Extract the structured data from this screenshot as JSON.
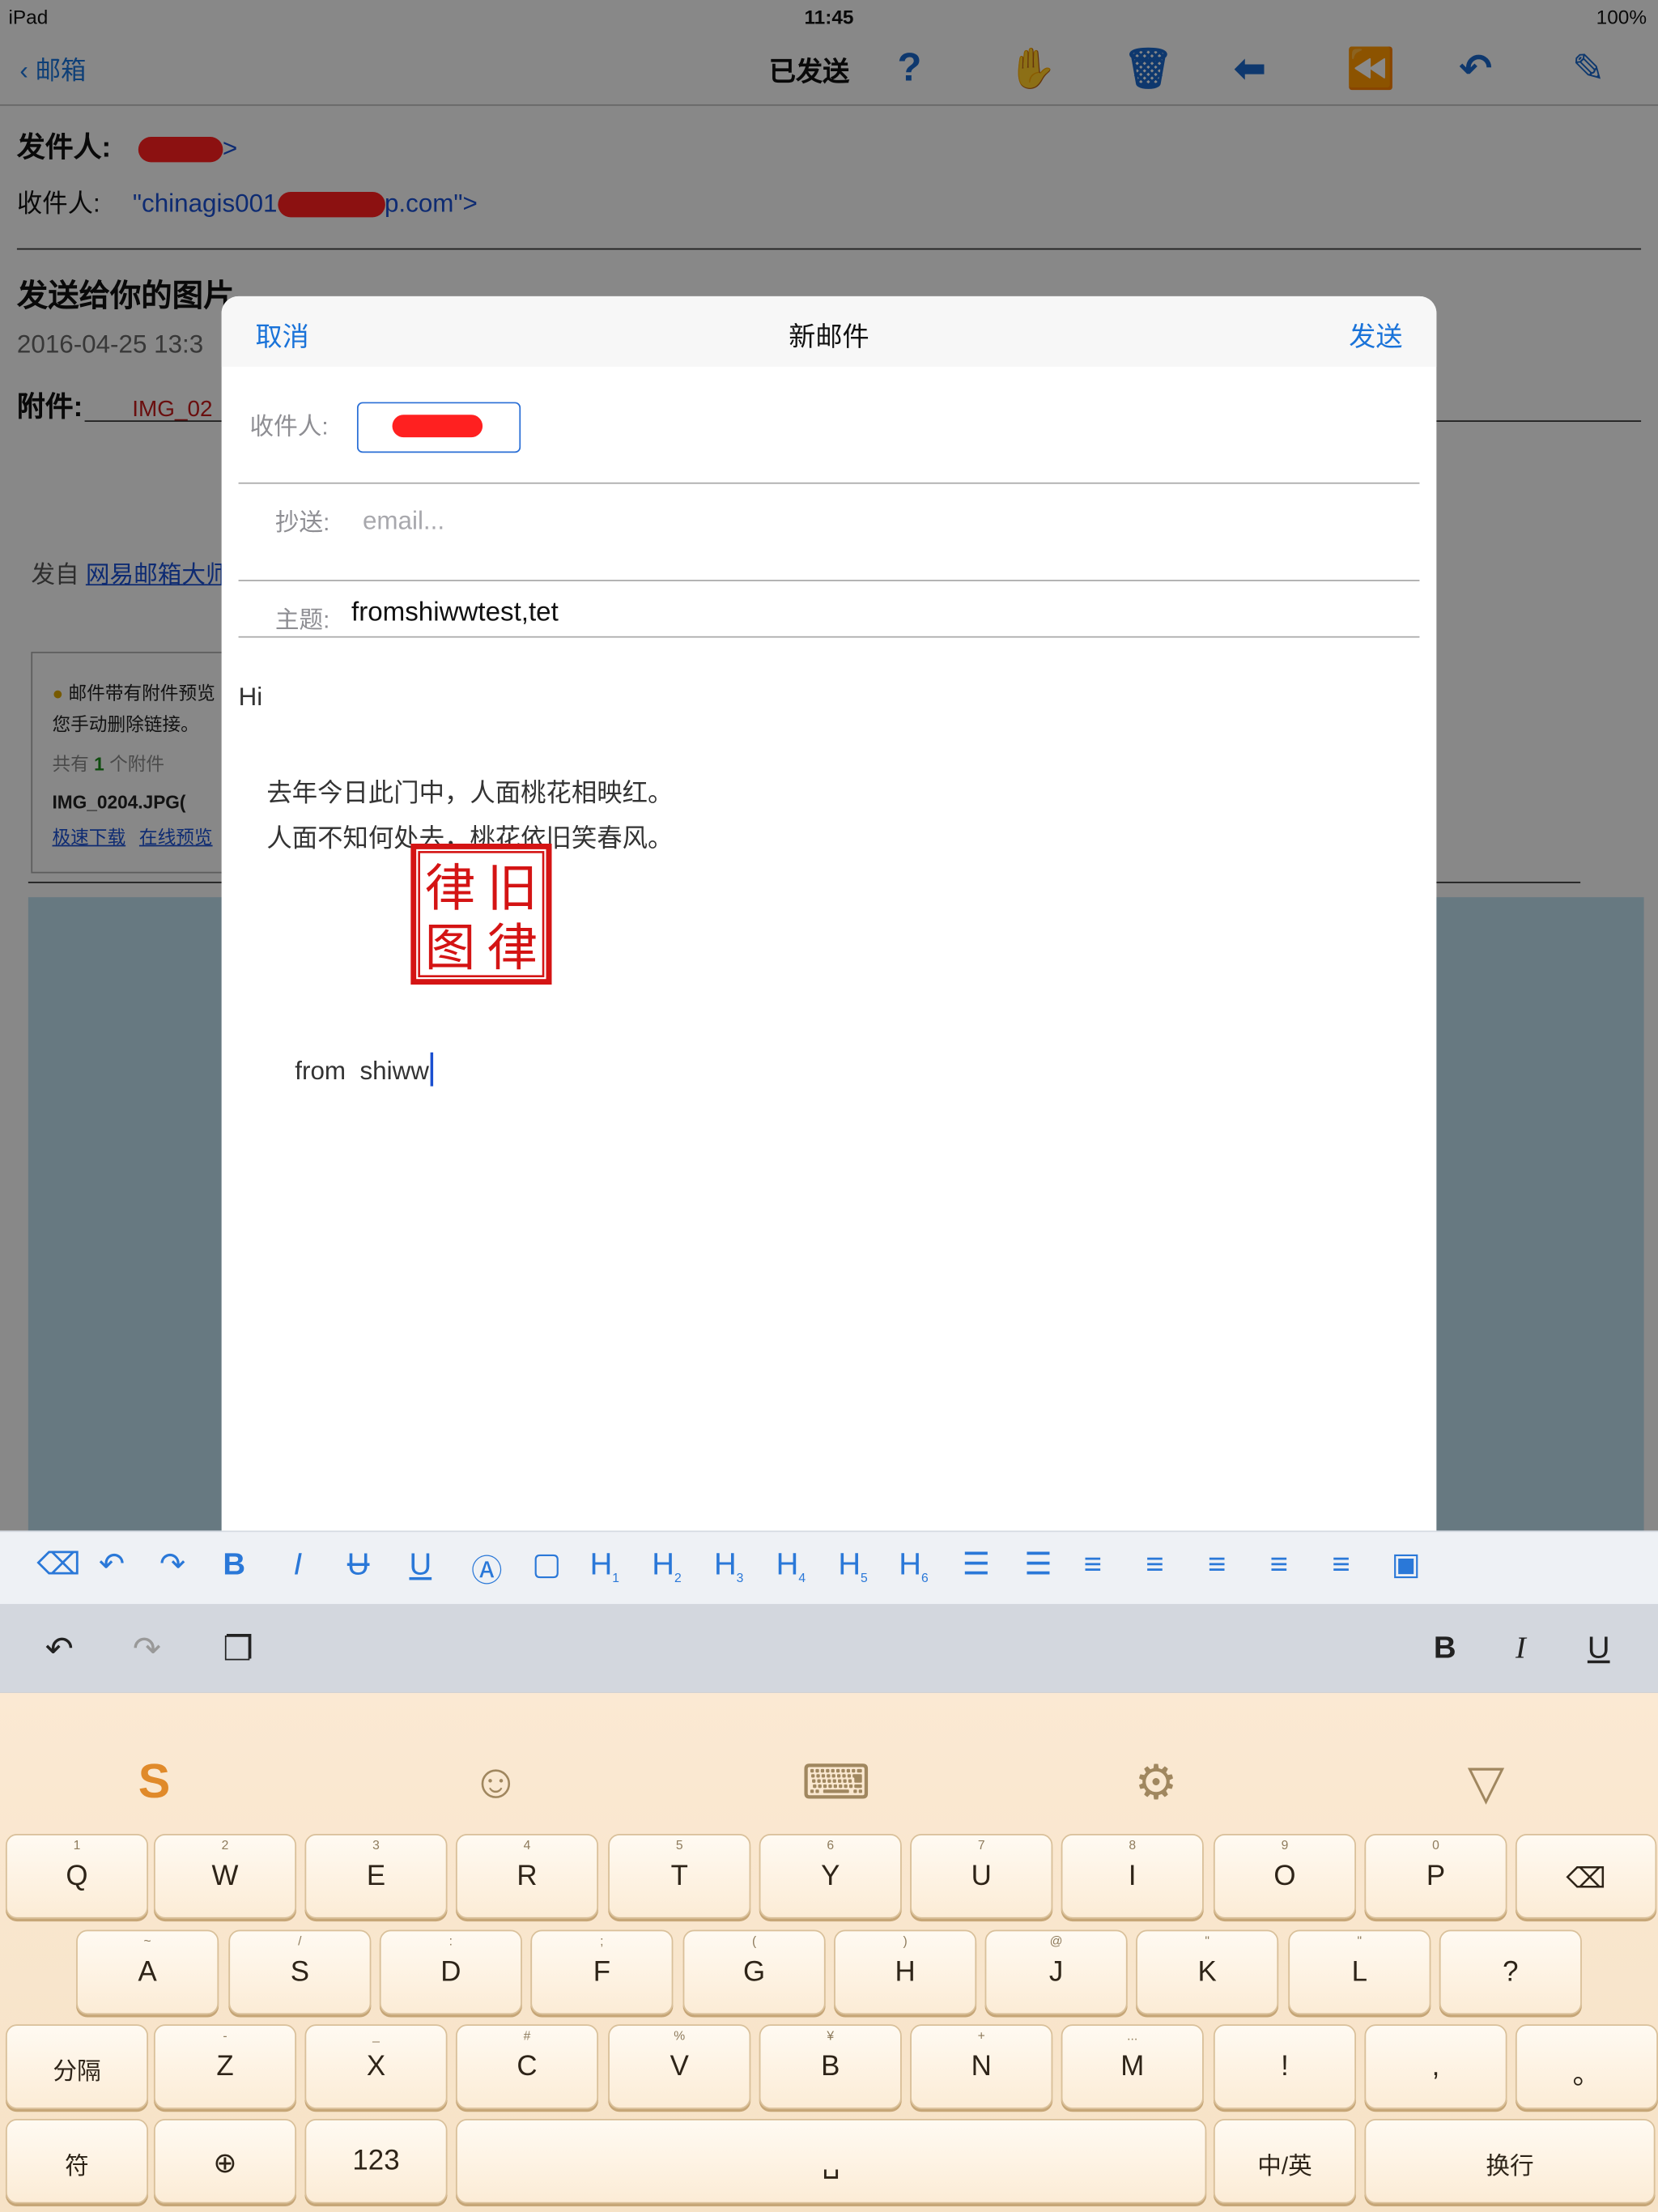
{
  "status": {
    "device": "iPad",
    "time": "11:45",
    "battery": "100%"
  },
  "mail_view": {
    "back_label": "邮箱",
    "folder_title": "已发送",
    "toolbar_icons": [
      "help-icon",
      "thumbs-down-icon",
      "trash-icon",
      "forward-arrow-icon",
      "reply-all-icon",
      "reply-icon",
      "brush-icon"
    ],
    "from_label": "发件人:",
    "from_suffix": ">",
    "to_label": "收件人:",
    "to_value_start": "\"chinagis001",
    "to_value_end": "p.com\">",
    "subject": "发送给你的图片",
    "date": "2016-04-25 13:3",
    "attachment_label": "附件:",
    "attachment_name": "IMG_02",
    "sent_from_prefix": "发自",
    "sent_from_link": "网易邮箱大师",
    "notice_line1": "邮件带有附件预览",
    "notice_line2": "您手动删除链接。",
    "count_prefix": "共有",
    "count_num": "1",
    "count_suffix": "个附件",
    "file_name": "IMG_0204.JPG(",
    "download_link": "极速下载",
    "preview_link": "在线预览"
  },
  "compose": {
    "cancel_label": "取消",
    "title": "新邮件",
    "send_label": "发送",
    "to_label": "收件人:",
    "cc_label": "抄送:",
    "cc_placeholder": "email...",
    "subject_label": "主题:",
    "subject_value": "fromshiwwtest,tet",
    "greeting": "Hi",
    "poem_line1": "去年今日此门中，人面桃花相映红。",
    "poem_line2": "人面不知何处去，桃花依旧笑春风。",
    "seal_text": [
      "旧",
      "律",
      "律",
      "图"
    ],
    "signature": "from  shiww"
  },
  "format_toolbar": {
    "items": [
      "eraser-icon",
      "undo-icon",
      "redo-icon",
      "bold-icon",
      "italic-icon",
      "strikethrough-icon",
      "underline-icon",
      "font-color-icon",
      "highlight-icon",
      "h1-icon",
      "h2-icon",
      "h3-icon",
      "h4-icon",
      "h5-icon",
      "h6-icon",
      "indent-icon",
      "outdent-icon",
      "ordered-list-icon",
      "unordered-list-icon",
      "align-left-icon",
      "align-center-icon",
      "align-right-icon",
      "insert-image-icon"
    ],
    "heading_subs": [
      "1",
      "2",
      "3",
      "4",
      "5",
      "6"
    ]
  },
  "shortcut_bar": {
    "bold": "B",
    "italic": "I",
    "underline": "U"
  },
  "keyboard": {
    "row1": [
      {
        "main": "Q",
        "sub": "1"
      },
      {
        "main": "W",
        "sub": "2"
      },
      {
        "main": "E",
        "sub": "3"
      },
      {
        "main": "R",
        "sub": "4"
      },
      {
        "main": "T",
        "sub": "5"
      },
      {
        "main": "Y",
        "sub": "6"
      },
      {
        "main": "U",
        "sub": "7"
      },
      {
        "main": "I",
        "sub": "8"
      },
      {
        "main": "O",
        "sub": "9"
      },
      {
        "main": "P",
        "sub": "0"
      }
    ],
    "row2": [
      {
        "main": "A",
        "sub": "~"
      },
      {
        "main": "S",
        "sub": "/"
      },
      {
        "main": "D",
        "sub": ":"
      },
      {
        "main": "F",
        "sub": ";"
      },
      {
        "main": "G",
        "sub": "("
      },
      {
        "main": "H",
        "sub": ")"
      },
      {
        "main": "J",
        "sub": "@"
      },
      {
        "main": "K",
        "sub": "\""
      },
      {
        "main": "L",
        "sub": "\""
      },
      {
        "main": "?",
        "sub": ""
      }
    ],
    "row3": [
      {
        "main": "分隔",
        "sub": ""
      },
      {
        "main": "Z",
        "sub": "-"
      },
      {
        "main": "X",
        "sub": "_"
      },
      {
        "main": "C",
        "sub": "#"
      },
      {
        "main": "V",
        "sub": "%"
      },
      {
        "main": "B",
        "sub": "¥"
      },
      {
        "main": "N",
        "sub": "+"
      },
      {
        "main": "M",
        "sub": "..."
      },
      {
        "main": "!",
        "sub": ""
      },
      {
        "main": ",",
        "sub": ""
      },
      {
        "main": "。",
        "sub": ""
      }
    ],
    "row4": [
      {
        "main": "符"
      },
      {
        "main": "⊕"
      },
      {
        "main": "123"
      },
      {
        "main": "␣"
      },
      {
        "main": "中/英"
      },
      {
        "main": "换行"
      }
    ]
  }
}
